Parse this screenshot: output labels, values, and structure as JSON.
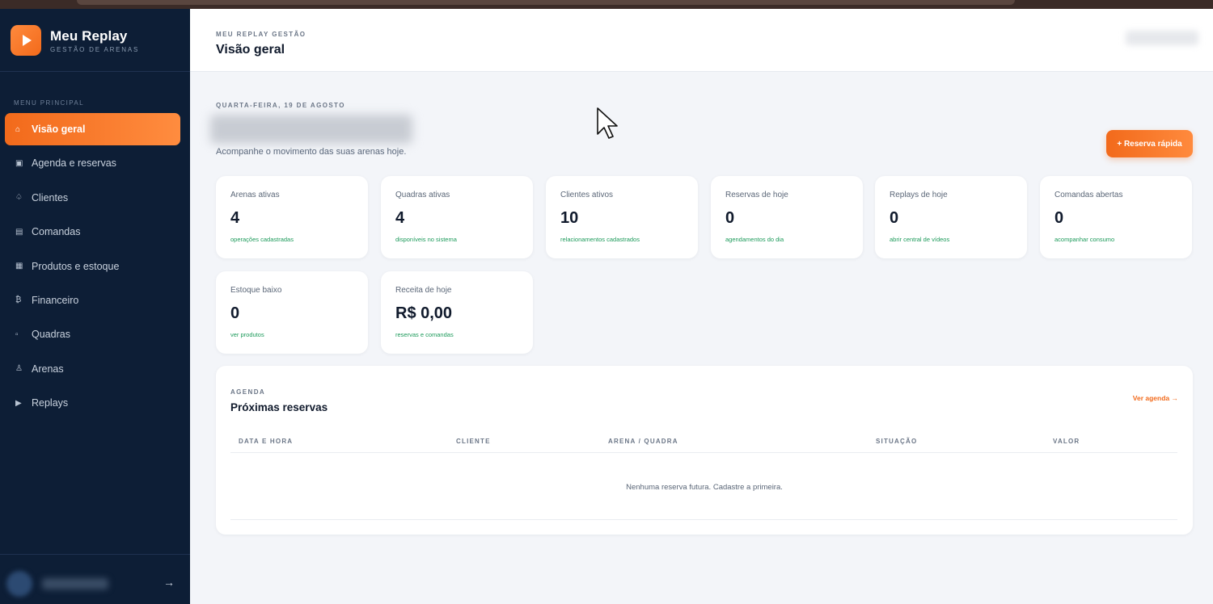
{
  "brand": {
    "name": "Meu Replay",
    "subtitle": "GESTÃO DE ARENAS"
  },
  "sidebar": {
    "menu_label": "MENU PRINCIPAL",
    "items": [
      {
        "label": "Visão geral",
        "icon": "home-icon",
        "glyph": "⌂",
        "active": true
      },
      {
        "label": "Agenda e reservas",
        "icon": "calendar-icon",
        "glyph": "▣"
      },
      {
        "label": "Clientes",
        "icon": "clients-icon",
        "glyph": "♤"
      },
      {
        "label": "Comandas",
        "icon": "orders-icon",
        "glyph": "▤"
      },
      {
        "label": "Produtos e estoque",
        "icon": "products-icon",
        "glyph": "▦"
      },
      {
        "label": "Financeiro",
        "icon": "finance-icon",
        "glyph": "₿"
      },
      {
        "label": "Quadras",
        "icon": "courts-icon",
        "glyph": "▫"
      },
      {
        "label": "Arenas",
        "icon": "arena-icon",
        "glyph": "♙"
      },
      {
        "label": "Replays",
        "icon": "play-icon",
        "glyph": "▶"
      }
    ],
    "logout_glyph": "→"
  },
  "header": {
    "kicker": "MEU REPLAY GESTÃO",
    "title": "Visão geral"
  },
  "hero": {
    "date": "QUARTA-FEIRA, 19 DE AGOSTO",
    "subtitle": "Acompanhe o movimento das suas arenas hoje.",
    "quick_button": "+ Reserva rápida"
  },
  "stats": [
    {
      "label": "Arenas ativas",
      "value": "4",
      "note": "operações cadastradas"
    },
    {
      "label": "Quadras ativas",
      "value": "4",
      "note": "disponíveis no sistema"
    },
    {
      "label": "Clientes ativos",
      "value": "10",
      "note": "relacionamentos cadastrados"
    },
    {
      "label": "Reservas de hoje",
      "value": "0",
      "note": "agendamentos do dia"
    },
    {
      "label": "Replays de hoje",
      "value": "0",
      "note": "abrir central de vídeos"
    },
    {
      "label": "Comandas abertas",
      "value": "0",
      "note": "acompanhar consumo"
    },
    {
      "label": "Estoque baixo",
      "value": "0",
      "note": "ver produtos"
    },
    {
      "label": "Receita de hoje",
      "value": "R$ 0,00",
      "note": "reservas e comandas"
    }
  ],
  "agenda": {
    "kicker": "AGENDA",
    "title": "Próximas reservas",
    "link": "Ver agenda →",
    "columns": [
      "DATA E HORA",
      "CLIENTE",
      "ARENA / QUADRA",
      "SITUAÇÃO",
      "VALOR"
    ],
    "empty": "Nenhuma reserva futura. Cadastre a primeira."
  },
  "colors": {
    "accent": "#f26a1b",
    "sidebar": "#0d1e36",
    "positive": "#1c9a5a"
  }
}
